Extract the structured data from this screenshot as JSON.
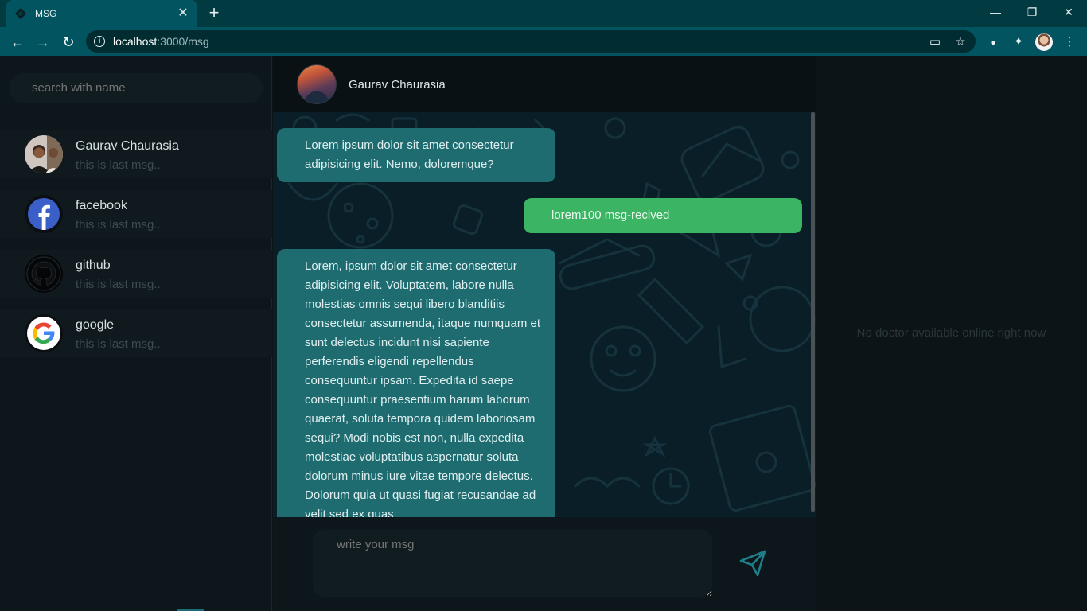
{
  "browser": {
    "tab_title": "MSG",
    "tab_close": "✕",
    "new_tab": "+",
    "url_host": "localhost",
    "url_path": ":3000/msg"
  },
  "sidebar": {
    "search_placeholder": "search with name",
    "contacts": [
      {
        "name": "Gaurav Chaurasia",
        "last_msg": "this is last msg..",
        "icon": "user-photo"
      },
      {
        "name": "facebook",
        "last_msg": "this is last msg..",
        "icon": "facebook-logo"
      },
      {
        "name": "github",
        "last_msg": "this is last msg..",
        "icon": "github-logo"
      },
      {
        "name": "google",
        "last_msg": "this is last msg..",
        "icon": "google-logo"
      }
    ]
  },
  "chat": {
    "header_name": "Gaurav Chaurasia",
    "messages": [
      {
        "direction": "in",
        "text": "Lorem ipsum dolor sit amet consectetur adipisicing elit. Nemo, doloremque?"
      },
      {
        "direction": "out",
        "text": "lorem100 msg-recived"
      },
      {
        "direction": "in",
        "text": "Lorem, ipsum dolor sit amet consectetur adipisicing elit. Voluptatem, labore nulla molestias omnis sequi libero blanditiis consectetur assumenda, itaque numquam et sunt delectus incidunt nisi sapiente perferendis eligendi repellendus consequuntur ipsam. Expedita id saepe consequuntur praesentium harum laborum quaerat, soluta tempora quidem laboriosam sequi? Modi nobis est non, nulla expedita molestiae voluptatibus aspernatur soluta dolorum minus iure vitae tempore delectus. Dolorum quia ut quasi fugiat recusandae ad velit sed ex quas"
      }
    ],
    "composer_placeholder": "write your msg"
  },
  "right_panel": {
    "empty_text": "No doctor available online right now"
  },
  "colors": {
    "incoming_bubble": "#1e6c70",
    "outgoing_bubble": "#3bb463",
    "browser_frame": "#025560"
  }
}
